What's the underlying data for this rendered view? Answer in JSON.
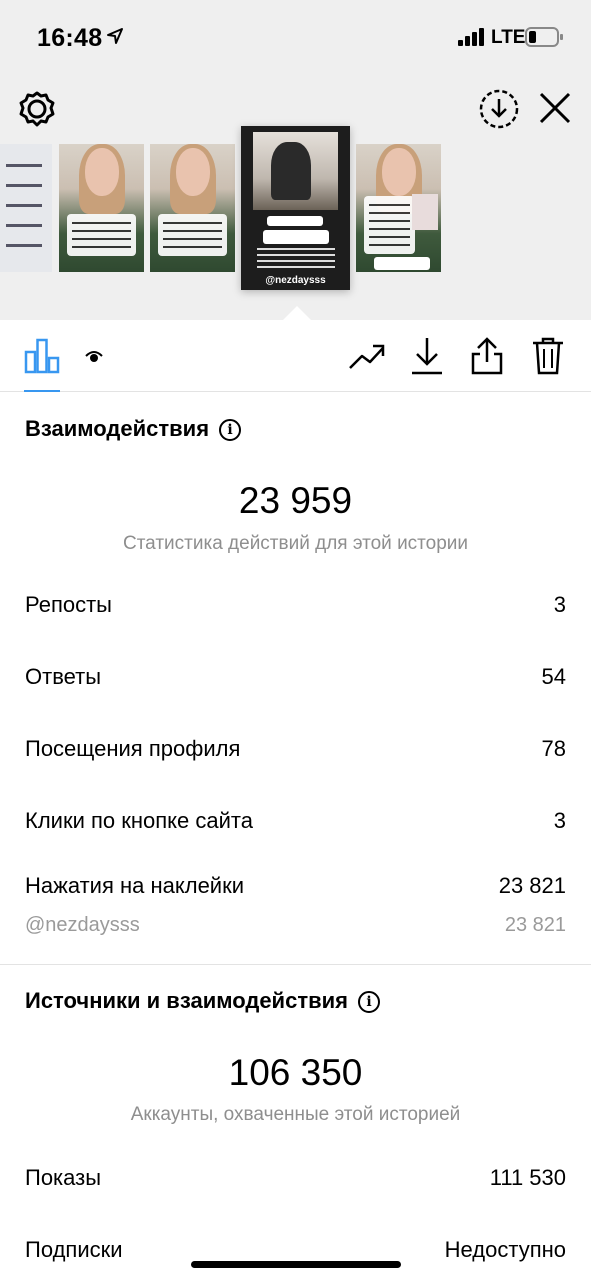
{
  "status_bar": {
    "time": "16:48",
    "network": "LTE"
  },
  "stories": {
    "selected_handle": "@nezdaysss",
    "side_handle": "@nezdaysss"
  },
  "engagement": {
    "title": "Взаимодействия",
    "total": "23 959",
    "subtitle": "Статистика действий для этой истории",
    "rows": [
      {
        "label": "Репосты",
        "value": "3"
      },
      {
        "label": "Ответы",
        "value": "54"
      },
      {
        "label": "Посещения профиля",
        "value": "78"
      },
      {
        "label": "Клики по кнопке сайта",
        "value": "3"
      },
      {
        "label": "Нажатия на наклейки",
        "value": "23 821"
      }
    ],
    "sticker_detail": {
      "label": "@nezdaysss",
      "value": "23 821"
    }
  },
  "reach": {
    "title": "Источники и взаимодействия",
    "total": "106 350",
    "subtitle": "Аккаунты, охваченные этой историей",
    "rows": [
      {
        "label": "Показы",
        "value": "111 530"
      },
      {
        "label": "Подписки",
        "value": "Недоступно"
      }
    ]
  },
  "colors": {
    "accent": "#3897f0",
    "muted_text": "#8e8e8e",
    "top_background": "#efefef"
  }
}
